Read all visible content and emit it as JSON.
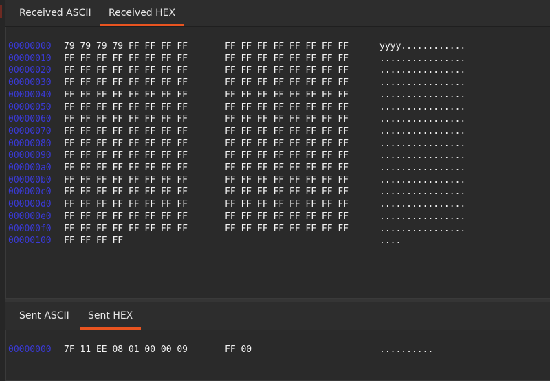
{
  "received": {
    "tabs": [
      {
        "label": "Received ASCII",
        "active": false
      },
      {
        "label": "Received HEX",
        "active": true
      }
    ],
    "rows": [
      {
        "addr": "00000000",
        "bytes1": "79 79 79 79 FF FF FF FF",
        "bytes2": "FF FF FF FF FF FF FF FF",
        "ascii": "yyyy............"
      },
      {
        "addr": "00000010",
        "bytes1": "FF FF FF FF FF FF FF FF",
        "bytes2": "FF FF FF FF FF FF FF FF",
        "ascii": "................"
      },
      {
        "addr": "00000020",
        "bytes1": "FF FF FF FF FF FF FF FF",
        "bytes2": "FF FF FF FF FF FF FF FF",
        "ascii": "................"
      },
      {
        "addr": "00000030",
        "bytes1": "FF FF FF FF FF FF FF FF",
        "bytes2": "FF FF FF FF FF FF FF FF",
        "ascii": "................"
      },
      {
        "addr": "00000040",
        "bytes1": "FF FF FF FF FF FF FF FF",
        "bytes2": "FF FF FF FF FF FF FF FF",
        "ascii": "................"
      },
      {
        "addr": "00000050",
        "bytes1": "FF FF FF FF FF FF FF FF",
        "bytes2": "FF FF FF FF FF FF FF FF",
        "ascii": "................"
      },
      {
        "addr": "00000060",
        "bytes1": "FF FF FF FF FF FF FF FF",
        "bytes2": "FF FF FF FF FF FF FF FF",
        "ascii": "................"
      },
      {
        "addr": "00000070",
        "bytes1": "FF FF FF FF FF FF FF FF",
        "bytes2": "FF FF FF FF FF FF FF FF",
        "ascii": "................"
      },
      {
        "addr": "00000080",
        "bytes1": "FF FF FF FF FF FF FF FF",
        "bytes2": "FF FF FF FF FF FF FF FF",
        "ascii": "................"
      },
      {
        "addr": "00000090",
        "bytes1": "FF FF FF FF FF FF FF FF",
        "bytes2": "FF FF FF FF FF FF FF FF",
        "ascii": "................"
      },
      {
        "addr": "000000a0",
        "bytes1": "FF FF FF FF FF FF FF FF",
        "bytes2": "FF FF FF FF FF FF FF FF",
        "ascii": "................"
      },
      {
        "addr": "000000b0",
        "bytes1": "FF FF FF FF FF FF FF FF",
        "bytes2": "FF FF FF FF FF FF FF FF",
        "ascii": "................"
      },
      {
        "addr": "000000c0",
        "bytes1": "FF FF FF FF FF FF FF FF",
        "bytes2": "FF FF FF FF FF FF FF FF",
        "ascii": "................"
      },
      {
        "addr": "000000d0",
        "bytes1": "FF FF FF FF FF FF FF FF",
        "bytes2": "FF FF FF FF FF FF FF FF",
        "ascii": "................"
      },
      {
        "addr": "000000e0",
        "bytes1": "FF FF FF FF FF FF FF FF",
        "bytes2": "FF FF FF FF FF FF FF FF",
        "ascii": "................"
      },
      {
        "addr": "000000f0",
        "bytes1": "FF FF FF FF FF FF FF FF",
        "bytes2": "FF FF FF FF FF FF FF FF",
        "ascii": "................"
      },
      {
        "addr": "00000100",
        "bytes1": "FF FF FF FF",
        "bytes2": "",
        "ascii": "...."
      }
    ]
  },
  "sent": {
    "tabs": [
      {
        "label": "Sent ASCII",
        "active": false
      },
      {
        "label": "Sent HEX",
        "active": true
      }
    ],
    "rows": [
      {
        "addr": "00000000",
        "bytes1": "7F 11 EE 08 01 00 00 09",
        "bytes2": "FF 00",
        "ascii": ".........."
      }
    ]
  },
  "colors": {
    "accent": "#e95420",
    "address": "#3a3ad6",
    "text": "#f2f2f2"
  }
}
